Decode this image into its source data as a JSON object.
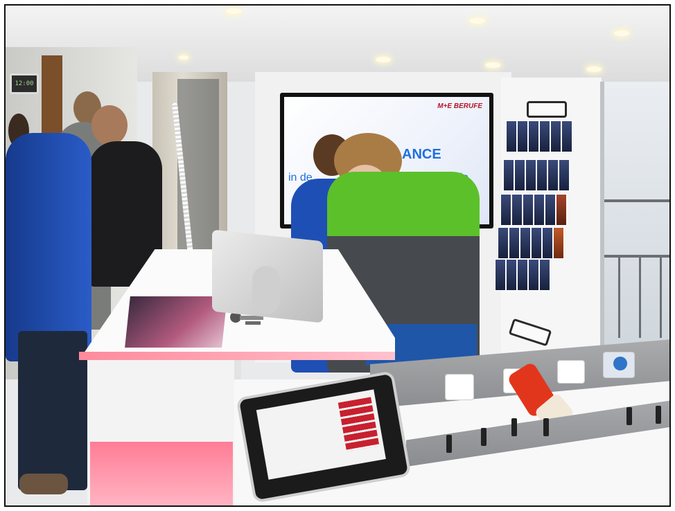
{
  "image": {
    "kind": "photograph",
    "scene": "interior of a mobile exhibition truck with interactive stations"
  },
  "tv_screen": {
    "logo": "M+E BERUFE",
    "headline": "ANCE",
    "subline_left": "in de",
    "subline_right": "dustrie",
    "accent_color": "#1f6fe0",
    "logo_color": "#b5142a"
  },
  "colors": {
    "table_glow": "#ff8a9c",
    "floor_red": "#9e1b24",
    "jacket_blue": "#1e4fb4",
    "jacket_green": "#5cc02a"
  }
}
